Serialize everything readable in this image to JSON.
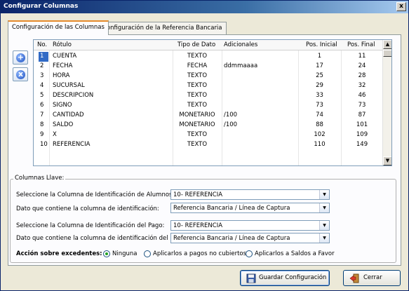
{
  "window": {
    "title": "Configurar Columnas",
    "close_label": "x"
  },
  "tabs": [
    {
      "label": "Configuración de las Columnas"
    },
    {
      "label": "Configuración de la Referencia Bancaria"
    }
  ],
  "side_buttons": {
    "add_symbol": "+",
    "remove_symbol": "x"
  },
  "grid": {
    "headers": [
      "No.",
      "Rótulo",
      "Tipo de Dato",
      "Adicionales",
      "Pos. Inicial",
      "Pos. Final"
    ],
    "rows": [
      {
        "no": "1",
        "rotulo": "CUENTA",
        "tipo": "TEXTO",
        "adicionales": "",
        "inicial": "1",
        "final": "11"
      },
      {
        "no": "2",
        "rotulo": "FECHA",
        "tipo": "FECHA",
        "adicionales": "ddmmaaaa",
        "inicial": "17",
        "final": "24"
      },
      {
        "no": "3",
        "rotulo": "HORA",
        "tipo": "TEXTO",
        "adicionales": "",
        "inicial": "25",
        "final": "28"
      },
      {
        "no": "4",
        "rotulo": "SUCURSAL",
        "tipo": "TEXTO",
        "adicionales": "",
        "inicial": "29",
        "final": "32"
      },
      {
        "no": "5",
        "rotulo": "DESCRIPCION",
        "tipo": "TEXTO",
        "adicionales": "",
        "inicial": "33",
        "final": "46"
      },
      {
        "no": "6",
        "rotulo": "SIGNO",
        "tipo": "TEXTO",
        "adicionales": "",
        "inicial": "73",
        "final": "73"
      },
      {
        "no": "7",
        "rotulo": "CANTIDAD",
        "tipo": "MONETARIO",
        "adicionales": "/100",
        "inicial": "74",
        "final": "87"
      },
      {
        "no": "8",
        "rotulo": "SALDO",
        "tipo": "MONETARIO",
        "adicionales": "/100",
        "inicial": "88",
        "final": "101"
      },
      {
        "no": "9",
        "rotulo": "X",
        "tipo": "TEXTO",
        "adicionales": "",
        "inicial": "102",
        "final": "109"
      },
      {
        "no": "10",
        "rotulo": "REFERENCIA",
        "tipo": "TEXTO",
        "adicionales": "",
        "inicial": "110",
        "final": "149"
      }
    ],
    "selected_row": 1,
    "scroll_up": "▲",
    "scroll_down": "▼"
  },
  "llave": {
    "legend": "Columnas Llave:",
    "alumnos_col_label": "Seleccione la Columna de Identificación de Alumnos:",
    "alumnos_col_value": "10- REFERENCIA",
    "alumnos_dato_label": "Dato que contiene la columna de identificación:",
    "alumnos_dato_value": "Referencia Bancaria / Línea de Captura",
    "pago_col_label": "Seleccione la Columna de Identificación del Pago:",
    "pago_col_value": "10- REFERENCIA",
    "pago_dato_label": "Dato que contiene la columna de identificación del pago:",
    "pago_dato_value": "Referencia Bancaria / Línea de Captura",
    "combo_arrow": "▼"
  },
  "excedentes": {
    "label": "Acción sobre excedentes:",
    "options": [
      "Ninguna",
      "Aplicarlos a pagos no cubiertos",
      "Aplicarlos a Saldos a Favor"
    ],
    "selected": 0
  },
  "buttons": {
    "save": "Guardar Configuración",
    "close": "Cerrar"
  }
}
